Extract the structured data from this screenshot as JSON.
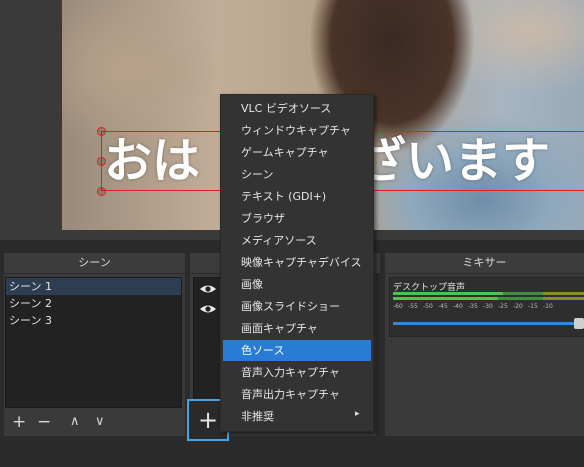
{
  "preview": {
    "overlay_text_left": "おは",
    "overlay_text_right": "ざいます"
  },
  "scenes": {
    "title": "シーン",
    "items": [
      "シーン 1",
      "シーン 2",
      "シーン 3"
    ],
    "selected_index": 0,
    "toolbar": {
      "add": "+",
      "remove": "−",
      "up": "∧",
      "down": "∨"
    }
  },
  "sources": {
    "add_label": "+",
    "visible_icons": [
      "eye-icon",
      "eye-icon"
    ]
  },
  "mixer": {
    "title": "ミキサー",
    "track_name": "デスクトップ音声",
    "scale": [
      "-60",
      "-55",
      "-50",
      "-45",
      "-40",
      "-35",
      "-30",
      "-25",
      "-20",
      "-15",
      "-10"
    ],
    "colors": {
      "green": "#4fc24f",
      "yellow": "#c8c23a",
      "slider": "#3a84d6"
    }
  },
  "context_menu": {
    "items": [
      "VLC ビデオソース",
      "ウィンドウキャプチャ",
      "ゲームキャプチャ",
      "シーン",
      "テキスト (GDI+)",
      "ブラウザ",
      "メディアソース",
      "映像キャプチャデバイス",
      "画像",
      "画像スライドショー",
      "画面キャプチャ",
      "色ソース",
      "音声入力キャプチャ",
      "音声出力キャプチャ",
      "非推奨"
    ],
    "highlighted_index": 11,
    "submenu_arrow": "▸"
  },
  "colors": {
    "accent": "#2a7bd4",
    "selection_border": "#e02020",
    "focus_border": "#4aa3e8"
  }
}
